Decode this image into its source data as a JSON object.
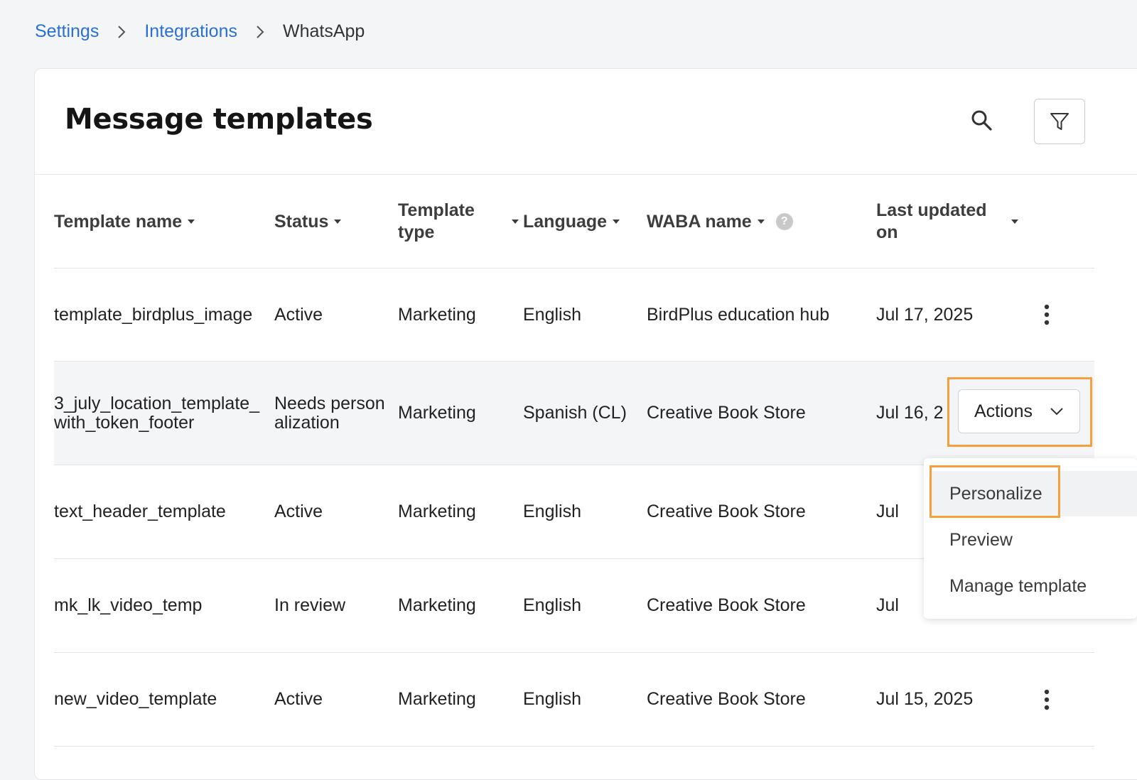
{
  "breadcrumb": {
    "items": [
      "Settings",
      "Integrations"
    ],
    "current": "WhatsApp"
  },
  "page": {
    "title": "Message templates"
  },
  "table": {
    "headers": {
      "name": "Template name",
      "status": "Status",
      "type_line1": "Template",
      "type_line2": "type",
      "language": "Language",
      "waba": "WABA name",
      "waba_help": "?",
      "updated_line1": "Last updated",
      "updated_line2": "on"
    },
    "rows": [
      {
        "name": "template_birdplus_image",
        "status": "Active",
        "type": "Marketing",
        "language": "English",
        "waba": "BirdPlus education hub",
        "updated": "Jul 17, 2025"
      },
      {
        "name": "3_july_location_template_with_token_footer",
        "status": "Needs personalization",
        "type": "Marketing",
        "language": "Spanish (CL)",
        "waba": "Creative Book Store",
        "updated": "Jul 16, 2"
      },
      {
        "name": "text_header_template",
        "status": "Active",
        "type": "Marketing",
        "language": "English",
        "waba": "Creative Book Store",
        "updated": "Jul"
      },
      {
        "name": "mk_lk_video_temp",
        "status": "In review",
        "type": "Marketing",
        "language": "English",
        "waba": "Creative Book Store",
        "updated": "Jul"
      },
      {
        "name": "new_video_template",
        "status": "Active",
        "type": "Marketing",
        "language": "English",
        "waba": "Creative Book Store",
        "updated": "Jul 15, 2025"
      }
    ]
  },
  "actions": {
    "button_label": "Actions",
    "menu": [
      "Personalize",
      "Preview",
      "Manage template"
    ]
  },
  "icons": {
    "search": "search-icon",
    "filter": "filter-icon",
    "more": "more-vertical-icon",
    "chevron": "chevron-down-icon",
    "separator": "chevron-right-icon"
  },
  "colors": {
    "link": "#2a6fd6",
    "active": "#4caf50",
    "warning": "#ef8a24",
    "highlight": "#f5a03c"
  }
}
